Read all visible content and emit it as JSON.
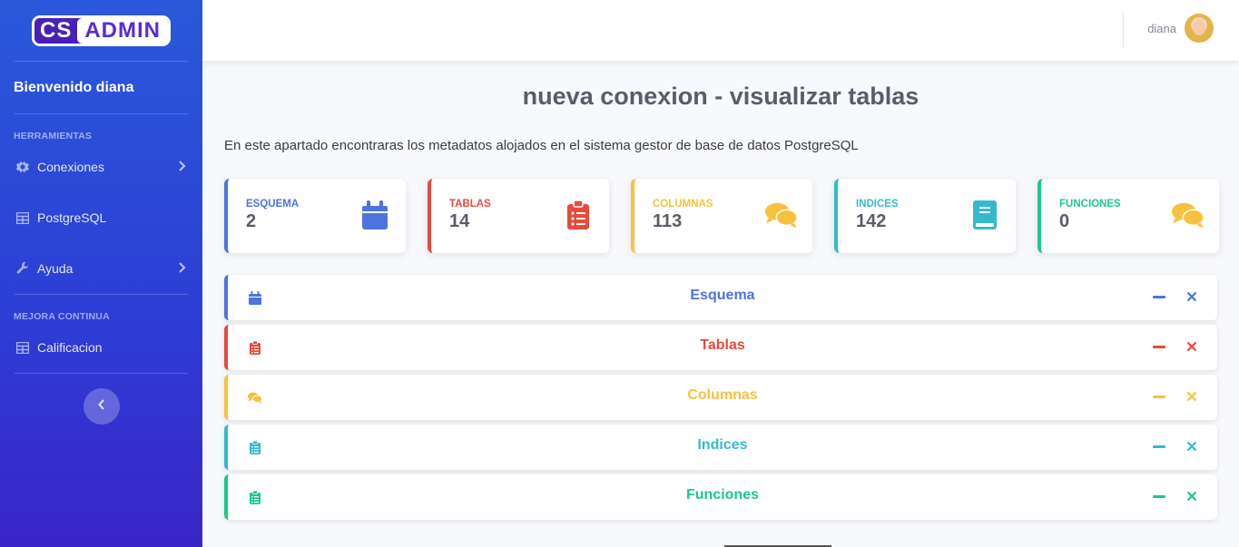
{
  "brand": {
    "cs": "CS",
    "admin": "ADMIN"
  },
  "sidebar": {
    "welcome": "Bienvenido diana",
    "sections": [
      {
        "heading": "HERRAMIENTAS"
      },
      {
        "heading": "MEJORA CONTINUA"
      }
    ],
    "items": [
      {
        "label": "Conexiones",
        "icon": "gear-icon"
      },
      {
        "label": "PostgreSQL",
        "icon": "table-icon"
      },
      {
        "label": "Ayuda",
        "icon": "wrench-icon"
      },
      {
        "label": "Calificacion",
        "icon": "table-icon"
      }
    ]
  },
  "topbar": {
    "username": "diana"
  },
  "main": {
    "title": "nueva conexion - visualizar tablas",
    "intro": "En este apartado encontraras los metadatos alojados en el sistema gestor de base de datos PostgreSQL",
    "cards": [
      {
        "title": "ESQUEMA",
        "value": "2",
        "color": "#4e73df",
        "icon": "calendar-icon"
      },
      {
        "title": "TABLAS",
        "value": "14",
        "color": "#e74a3b",
        "icon": "clipboard-list-icon"
      },
      {
        "title": "COLUMNAS",
        "value": "113",
        "color": "#f6c23e",
        "icon": "comments-icon"
      },
      {
        "title": "INDICES",
        "value": "142",
        "color": "#36b9cc",
        "icon": "book-icon"
      },
      {
        "title": "FUNCIONES",
        "value": "0",
        "color": "#1cc88a",
        "icon": "comments-icon"
      }
    ],
    "panels": [
      {
        "title": "Esquema",
        "color": "#4e73df",
        "icon": "calendar-icon"
      },
      {
        "title": "Tablas",
        "color": "#e74a3b",
        "icon": "clipboard-list-icon"
      },
      {
        "title": "Columnas",
        "color": "#f6c23e",
        "icon": "comments-icon"
      },
      {
        "title": "Indices",
        "color": "#36b9cc",
        "icon": "clipboard-list-icon"
      },
      {
        "title": "Funciones",
        "color": "#1cc88a",
        "icon": "clipboard-list-icon"
      }
    ]
  }
}
